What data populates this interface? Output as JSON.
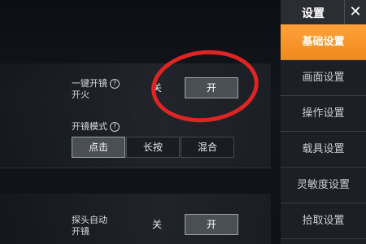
{
  "sidebar": {
    "title": "设置",
    "close": "✕",
    "items": [
      {
        "label": "基础设置",
        "active": true
      },
      {
        "label": "画面设置"
      },
      {
        "label": "操作设置"
      },
      {
        "label": "载具设置"
      },
      {
        "label": "灵敏度设置"
      },
      {
        "label": "拾取设置"
      }
    ]
  },
  "settings": {
    "one_key_scope": {
      "label_line1": "一键开镜",
      "label_line2": "开火",
      "help": "?",
      "off": "关",
      "on": "开",
      "selected": "开"
    },
    "scope_mode": {
      "label": "开镜模式",
      "help": "?",
      "options": [
        "点击",
        "长按",
        "混合"
      ],
      "selected": "点击"
    },
    "peek_auto_scope": {
      "label_line1": "探头自动",
      "label_line2": "开镜",
      "off": "关",
      "on": "开",
      "selected": "开"
    }
  },
  "colors": {
    "accent": "#f5921e",
    "annotation": "#e02424"
  }
}
